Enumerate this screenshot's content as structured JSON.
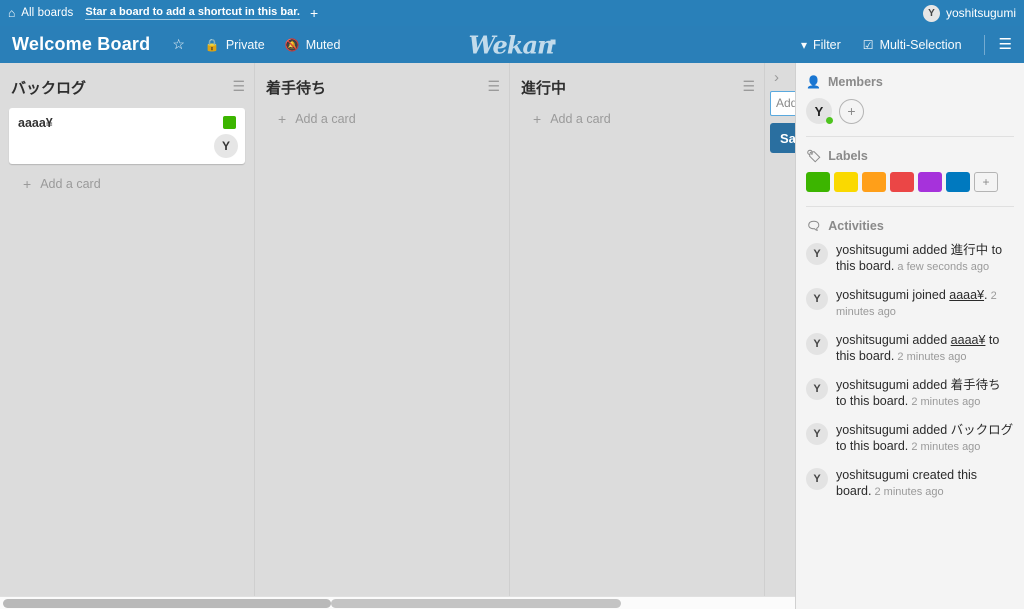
{
  "topbar": {
    "home_icon": "home-icon",
    "all_boards": "All boards",
    "shortcut_hint": "Star a board to add a shortcut in this bar.",
    "plus": "+",
    "user_initial": "Y",
    "username": "yoshitsugumi"
  },
  "board_header": {
    "title": "Welcome Board",
    "star_icon": "☆",
    "visibility_icon": "lock-icon",
    "visibility": "Private",
    "mute_icon": "bell-slash-icon",
    "mute": "Muted",
    "logo_text": "Wekan",
    "filter_icon": "filter-icon",
    "filter": "Filter",
    "multiselect_icon": "checkbox-icon",
    "multiselect": "Multi-Selection",
    "menu_icon": "hamburger-icon"
  },
  "lists": [
    {
      "title": "バックログ",
      "menu_icon": "hamburger-icon",
      "add_card": "Add a card",
      "cards": [
        {
          "title": "aaaa¥",
          "label_color": "#3cb500",
          "member_initial": "Y"
        }
      ]
    },
    {
      "title": "着手待ち",
      "menu_icon": "hamburger-icon",
      "add_card": "Add a card",
      "cards": []
    },
    {
      "title": "進行中",
      "menu_icon": "hamburger-icon",
      "add_card": "Add a card",
      "cards": []
    }
  ],
  "add_list_form": {
    "chevron": "›",
    "input_value": "Add",
    "submit_label": "Save"
  },
  "sidebar": {
    "members": {
      "icon": "person-icon",
      "title": "Members",
      "member_initial": "Y",
      "add_label": "+"
    },
    "labels": {
      "icon": "tag-icon",
      "title": "Labels",
      "colors": [
        "#3cb500",
        "#fad900",
        "#ff9f19",
        "#eb4646",
        "#a632db",
        "#0079bf"
      ],
      "add_label": "+"
    },
    "activities": {
      "icon": "comment-icon",
      "title": "Activities",
      "items": [
        {
          "avatar": "Y",
          "actor": "yoshitsugumi",
          "action": " added ",
          "target": "進行中",
          "suffix": " to this board.",
          "timestamp": "a few seconds ago",
          "target_underlined": false
        },
        {
          "avatar": "Y",
          "actor": "yoshitsugumi",
          "action": " joined ",
          "target": "aaaa¥",
          "suffix": ".",
          "timestamp": "2 minutes ago",
          "target_underlined": true
        },
        {
          "avatar": "Y",
          "actor": "yoshitsugumi",
          "action": " added ",
          "target": "aaaa¥",
          "suffix": " to this board.",
          "timestamp": "2 minutes ago",
          "target_underlined": true
        },
        {
          "avatar": "Y",
          "actor": "yoshitsugumi",
          "action": " added ",
          "target": "着手待ち",
          "suffix": " to this board.",
          "timestamp": "2 minutes ago",
          "target_underlined": false
        },
        {
          "avatar": "Y",
          "actor": "yoshitsugumi",
          "action": " added ",
          "target": "バックログ",
          "suffix": " to this board.",
          "timestamp": "2 minutes ago",
          "target_underlined": false
        },
        {
          "avatar": "Y",
          "actor": "yoshitsugumi",
          "action": " created this board.",
          "target": "",
          "suffix": "",
          "timestamp": "2 minutes ago",
          "target_underlined": false
        }
      ]
    }
  },
  "colors": {
    "topbar_bg": "#2980b9",
    "header_bg": "#2a7fb8",
    "board_bg": "#dcdcdc",
    "sidebar_bg": "#f4f4f4"
  }
}
